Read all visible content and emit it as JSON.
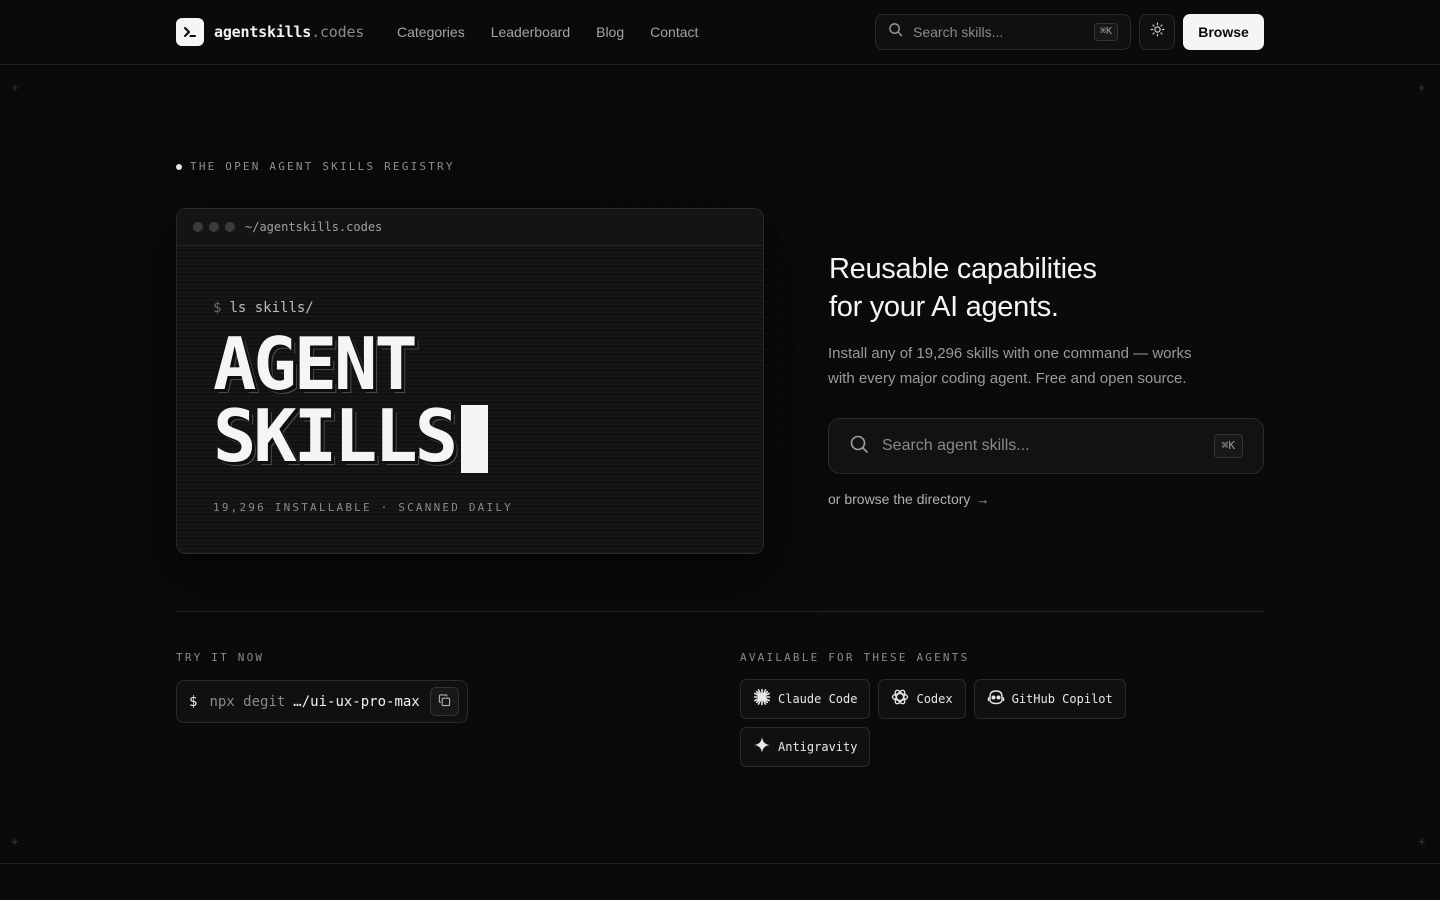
{
  "brand": {
    "name": "agentskills",
    "suffix": ".codes"
  },
  "nav": [
    {
      "label": "Categories"
    },
    {
      "label": "Leaderboard"
    },
    {
      "label": "Blog"
    },
    {
      "label": "Contact"
    }
  ],
  "header_search": {
    "placeholder": "Search skills...",
    "shortcut": "⌘K"
  },
  "theme_toggle": {
    "icon": "sun-icon"
  },
  "browse_button": {
    "label": "Browse"
  },
  "eyebrow": "THE OPEN AGENT SKILLS REGISTRY",
  "terminal": {
    "path": "~/agentskills.codes",
    "prompt_symbol": "$",
    "command": "ls skills/",
    "title_line1": "AGENT",
    "title_line2": "SKILLS",
    "footer": "19,296 INSTALLABLE · SCANNED DAILY"
  },
  "hero": {
    "headline_line1": "Reusable capabilities",
    "headline_line2": "for your AI agents.",
    "sub_line1": "Install any of 19,296 skills with one command — works",
    "sub_line2": "with every major coding agent. Free and open source.",
    "search_placeholder": "Search agent skills...",
    "search_shortcut": "⌘K",
    "browse_link": "or browse the directory",
    "browse_arrow": "→"
  },
  "try_now": {
    "label": "TRY IT NOW",
    "prompt": "$",
    "cmd_prefix": "npx degit",
    "cmd_target": "…/ui-ux-pro-max"
  },
  "agents": {
    "label": "AVAILABLE FOR THESE AGENTS",
    "items": [
      {
        "name": "Claude Code",
        "icon": "claude-icon"
      },
      {
        "name": "Codex",
        "icon": "openai-icon"
      },
      {
        "name": "GitHub Copilot",
        "icon": "copilot-icon"
      },
      {
        "name": "Antigravity",
        "icon": "sparkle-icon"
      }
    ]
  },
  "colors": {
    "background": "#0a0a0a",
    "text": "#ededed",
    "muted": "#8a8a8a",
    "border": "#2a2a2a"
  }
}
